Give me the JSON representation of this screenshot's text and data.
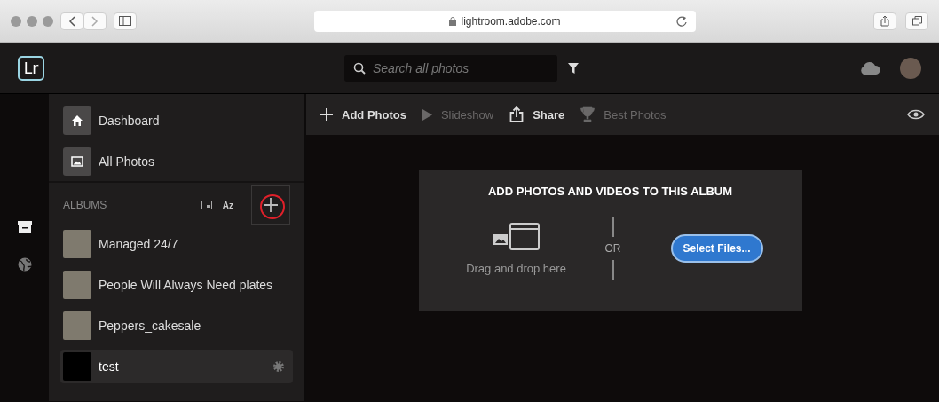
{
  "browser": {
    "url": "lightroom.adobe.com"
  },
  "header": {
    "logo": "Lr",
    "search": {
      "placeholder": "Search all photos"
    }
  },
  "sidebar": {
    "nav": [
      {
        "label": "Dashboard",
        "kind": "home",
        "selected": false
      },
      {
        "label": "All Photos",
        "kind": "photos",
        "selected": false
      }
    ],
    "albums_heading": "ALBUMS",
    "sort_label": "Az",
    "add_highlighted": true,
    "albums": [
      {
        "name": "Managed 24/7",
        "selected": false,
        "has_photo": true
      },
      {
        "name": "People Will Always Need plates",
        "selected": false,
        "has_photo": true
      },
      {
        "name": "Peppers_cakesale",
        "selected": false,
        "has_photo": true
      },
      {
        "name": "test",
        "selected": true,
        "has_photo": false
      }
    ]
  },
  "toolbar": [
    {
      "label": "Add Photos",
      "kind": "add",
      "disabled": false
    },
    {
      "label": "Slideshow",
      "kind": "play",
      "disabled": true
    },
    {
      "label": "Share",
      "kind": "share",
      "disabled": false
    },
    {
      "label": "Best Photos",
      "kind": "trophy",
      "disabled": true
    }
  ],
  "drop": {
    "title": "ADD PHOTOS AND VIDEOS TO THIS ALBUM",
    "hint": "Drag and drop here",
    "or": "OR",
    "button": "Select Files..."
  }
}
